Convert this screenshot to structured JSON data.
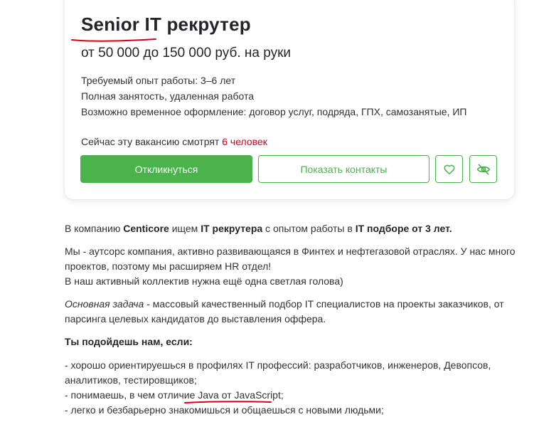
{
  "vacancy": {
    "title": "Senior IT рекрутер",
    "salary": "от 50 000 до 150 000 руб. на руки",
    "experience": "Требуемый опыт работы: 3–6 лет",
    "employment": "Полная занятость, удаленная работа",
    "contract_types": "Возможно временное оформление: договор услуг, подряда, ГПХ, самозанятые, ИП",
    "viewers_prefix": "Сейчас эту вакансию смотрят ",
    "viewers_count": "6 человек",
    "respond_label": "Откликнуться",
    "contacts_label": "Показать контакты",
    "favorite_icon": "heart-icon",
    "hide_icon": "eye-off-icon",
    "accent_color": "#4bb34b",
    "alert_color": "#d6001c",
    "annotation_color": "#d6001c"
  },
  "description": {
    "p1_a": "В компанию ",
    "p1_b": "Centicore",
    "p1_c": " ищем ",
    "p1_d": "IT рекрутера",
    "p1_e": " с опытом работы в ",
    "p1_f": "IT подборе от 3 лет.",
    "p2_line1": "Мы - аутсорс компания, активно развивающаяся в Финтех и нефтегазовой отраслях. У нас много",
    "p2_line2": "проектов, поэтому мы расширяем HR отдел!",
    "p2_line3": "В наш активный коллектив нужна ещё одна светлая голова)",
    "p3_task": "Основная задача",
    "p3_line1_rest": " - массовый качественный подбор IT специалистов на проекты заказчиков, от",
    "p3_line2": "парсинга целевых кандидатов до выставления оффера.",
    "fit_heading": "Ты подойдешь нам, если:",
    "fit1_line1": "- хорошо ориентируешься в профилях IT профессий: разработчиков, инженеров, Девопсов,",
    "fit1_line2": "аналитиков, тестировщиков;",
    "fit2": "- понимаешь, в чем отличие Java от JavaScript;",
    "fit3": "- легко и безбарьерно знакомишься и общаешься с новыми людьми;"
  }
}
